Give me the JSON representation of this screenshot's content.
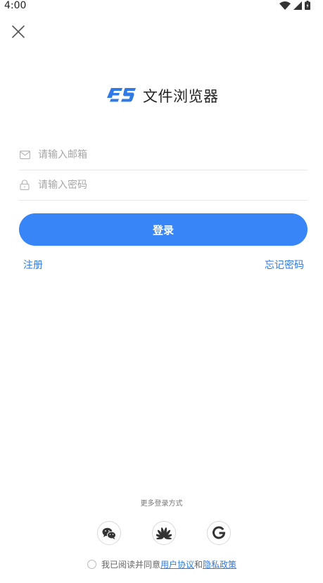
{
  "status_bar": {
    "time": "4:00"
  },
  "app": {
    "name": "文件浏览器",
    "brand_color": "#3785f7"
  },
  "form": {
    "email_placeholder": "请输入邮箱",
    "password_placeholder": "请输入密码",
    "login_label": "登录",
    "register_label": "注册",
    "forgot_label": "忘记密码"
  },
  "more_login": {
    "label": "更多登录方式",
    "providers": [
      "wechat-icon",
      "huawei-icon",
      "google-icon"
    ]
  },
  "agreement": {
    "prefix": "我已阅读并同意",
    "user_agreement": "用户协议",
    "conjunction": "和",
    "privacy_policy": "隐私政策"
  }
}
